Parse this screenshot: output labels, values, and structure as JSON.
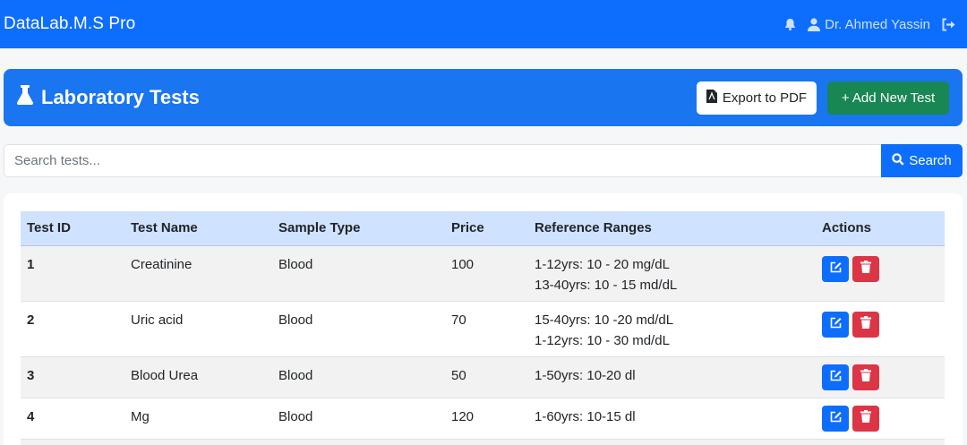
{
  "navbar": {
    "brand": "DataLab.M.S Pro",
    "user_name": "Dr. Ahmed Yassin"
  },
  "header": {
    "title": "Laboratory Tests",
    "export_label": "Export to PDF",
    "add_label": "+ Add New Test"
  },
  "search": {
    "placeholder": "Search tests...",
    "button_label": "Search"
  },
  "table": {
    "columns": [
      "Test ID",
      "Test Name",
      "Sample Type",
      "Price",
      "Reference Ranges",
      "Actions"
    ],
    "rows": [
      {
        "id": "1",
        "name": "Creatinine",
        "sample": "Blood",
        "price": "100",
        "ranges": [
          "1-12yrs: 10 - 20 mg/dL",
          "13-40yrs: 10 - 15 md/dL"
        ]
      },
      {
        "id": "2",
        "name": "Uric acid",
        "sample": "Blood",
        "price": "70",
        "ranges": [
          "15-40yrs: 10 -20 md/dL",
          "1-12yrs: 10 - 30 md/dL"
        ]
      },
      {
        "id": "3",
        "name": "Blood Urea",
        "sample": "Blood",
        "price": "50",
        "ranges": [
          "1-50yrs: 10-20 dl"
        ]
      },
      {
        "id": "4",
        "name": "Mg",
        "sample": "Blood",
        "price": "120",
        "ranges": [
          "1-60yrs: 10-15 dl"
        ]
      }
    ]
  },
  "icons": {
    "bell": "bell-icon",
    "user": "user-icon",
    "logout": "sign-out-icon",
    "flask": "flask-icon",
    "pdf": "file-pdf-icon",
    "search": "search-icon",
    "edit": "edit-icon",
    "delete": "trash-icon"
  },
  "colors": {
    "primary": "#0d6efd",
    "success": "#198754",
    "danger": "#dc3545",
    "table_header": "#cfe2ff"
  }
}
